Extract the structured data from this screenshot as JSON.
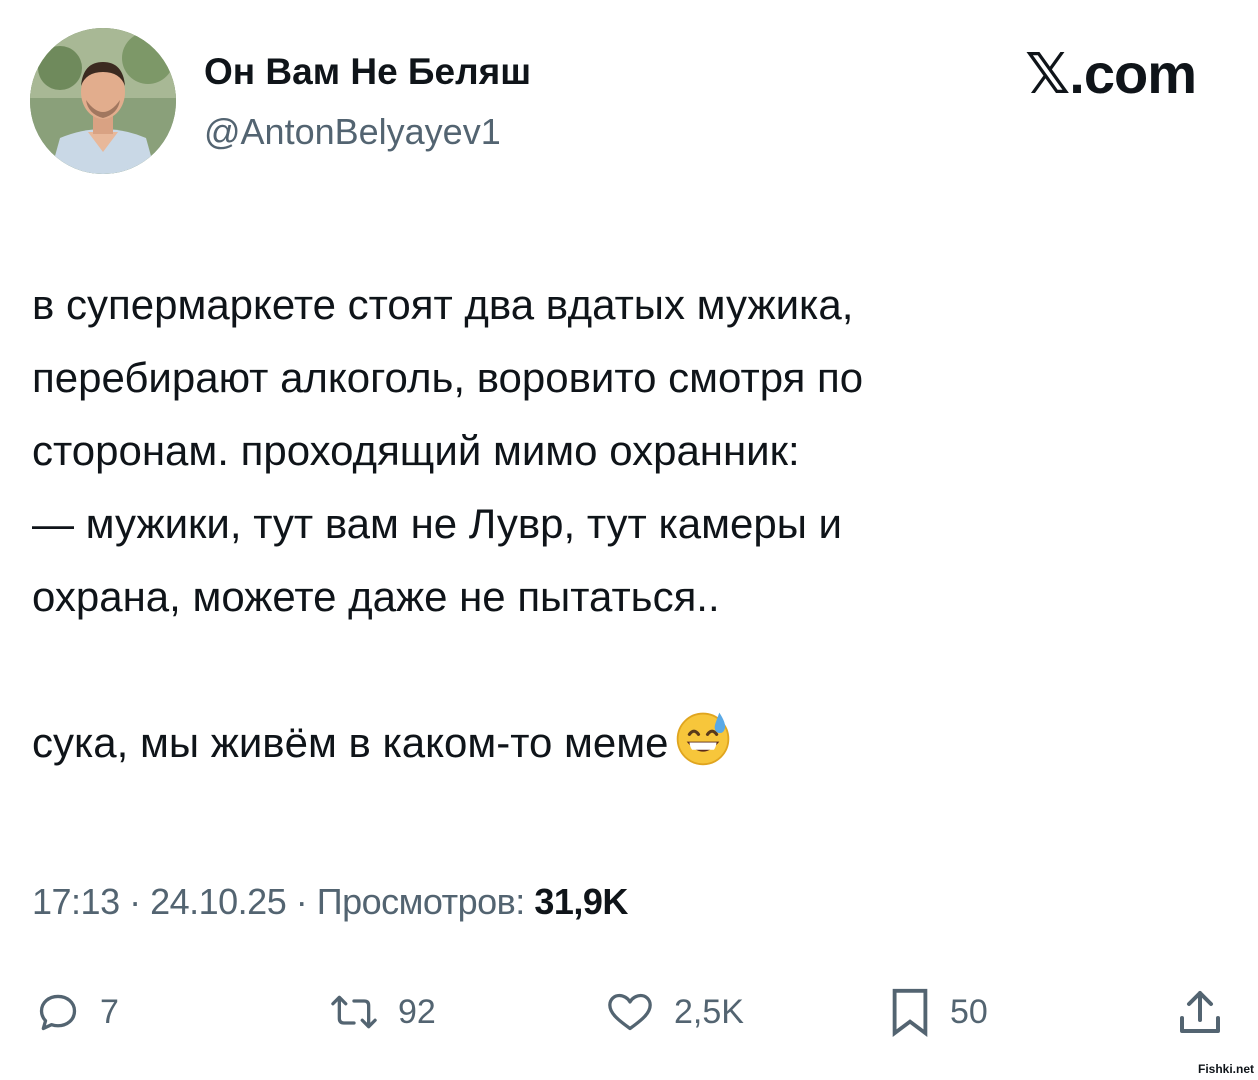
{
  "author": {
    "display_name": "Он Вам Не Беляш",
    "handle": "@AntonBelyayev1",
    "avatar": "avatar-photo"
  },
  "brand": {
    "label": "𝕏.com"
  },
  "tweet": {
    "lines": [
      "в супермаркете стоят два вдатых мужика,",
      "перебирают алкоголь, воровито смотря по",
      "сторонам. проходящий мимо охранник:",
      "— мужики, тут вам не Лувр, тут камеры и",
      "охрана, можете даже не пытаться.."
    ],
    "last_line": "сука, мы живём в каком-то меме",
    "emoji": "grinning-face-with-sweat"
  },
  "meta": {
    "time": "17:13",
    "separator": " · ",
    "date": "24.10.25",
    "views_label": "Просмотров:",
    "views_count": "31,9K"
  },
  "actions": {
    "replies": "7",
    "retweets": "92",
    "likes": "2,5K",
    "bookmarks": "50"
  },
  "watermark": "Fishki.net",
  "colors": {
    "text": "#0f1419",
    "secondary": "#536471",
    "background": "#ffffff"
  }
}
